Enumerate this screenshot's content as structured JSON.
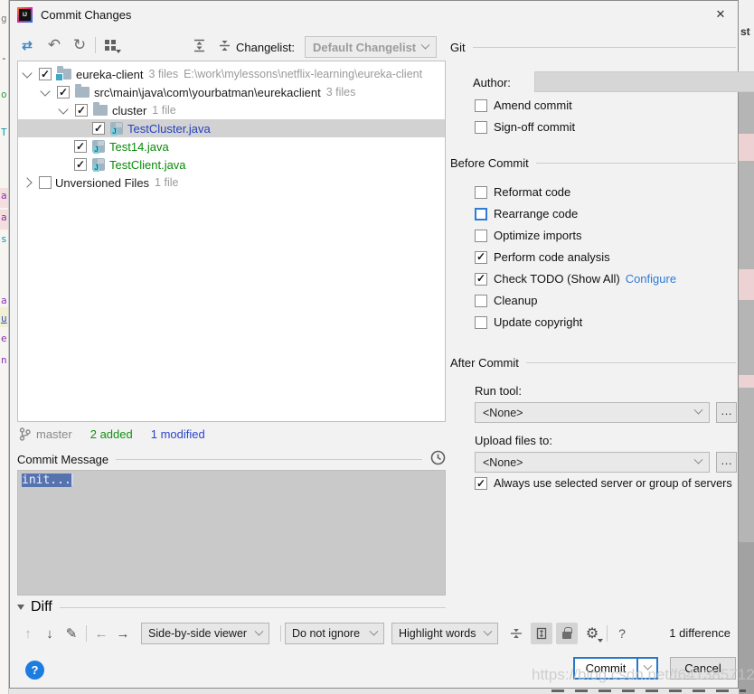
{
  "window": {
    "title": "Commit Changes"
  },
  "background": {
    "right_text": "st"
  },
  "icons": {
    "show_diff": "⇄",
    "rollback": "↶",
    "refresh": "↻",
    "check": "✓",
    "up": "↑",
    "down": "↓",
    "pencil": "✎",
    "left": "←",
    "right": "→",
    "gear": "⚙",
    "help": "?",
    "close": "✕",
    "dots": "…",
    "app_logo": "IJ"
  },
  "changelist": {
    "label": "Changelist:",
    "value": "Default Changelist"
  },
  "tree": {
    "rows": [
      {
        "name": "eureka-client",
        "meta": "3 files",
        "path": "E:\\work\\mylessons\\netflix-learning\\eureka-client",
        "checked": true,
        "expanded": true
      },
      {
        "name": "src\\main\\java\\com\\yourbatman\\eurekaclient",
        "meta": "3 files",
        "checked": true,
        "expanded": true
      },
      {
        "name": "cluster",
        "meta": "1 file",
        "checked": true,
        "expanded": true
      },
      {
        "name": "TestCluster.java",
        "checked": true,
        "selected": true,
        "status": "modified"
      },
      {
        "name": "Test14.java",
        "checked": true,
        "status": "added"
      },
      {
        "name": "TestClient.java",
        "checked": true,
        "status": "added"
      },
      {
        "name": "Unversioned Files",
        "meta": "1 file",
        "checked": false,
        "expanded": false
      }
    ]
  },
  "status": {
    "branch": "master",
    "added": "2 added",
    "modified": "1 modified"
  },
  "commit_message": {
    "header": "Commit Message",
    "value": "init..."
  },
  "git_panel": {
    "header": "Git",
    "author_label": "Author:",
    "author_value": "",
    "amend_label": "Amend commit",
    "signoff_label": "Sign-off commit"
  },
  "before_commit": {
    "header": "Before Commit",
    "items": [
      {
        "label": "Reformat code",
        "checked": false
      },
      {
        "label": "Rearrange code",
        "checked": false,
        "focused": true
      },
      {
        "label": "Optimize imports",
        "checked": false
      },
      {
        "label": "Perform code analysis",
        "checked": true
      },
      {
        "label": "Check TODO (Show All)",
        "checked": true,
        "link": "Configure"
      },
      {
        "label": "Cleanup",
        "checked": false
      },
      {
        "label": "Update copyright",
        "checked": false
      }
    ]
  },
  "after_commit": {
    "header": "After Commit",
    "run_tool_label": "Run tool:",
    "run_tool_value": "<None>",
    "upload_label": "Upload files to:",
    "upload_value": "<None>",
    "always_label": "Always use selected server or group of servers",
    "always_checked": true
  },
  "diff": {
    "header": "Diff",
    "viewer_value": "Side-by-side viewer",
    "ignore_value": "Do not ignore",
    "highlight_value": "Highlight words",
    "count": "1 difference"
  },
  "footer": {
    "commit_label": "Commit",
    "cancel_label": "Cancel"
  },
  "watermark": "https://blog.csdn.net/f641385712"
}
